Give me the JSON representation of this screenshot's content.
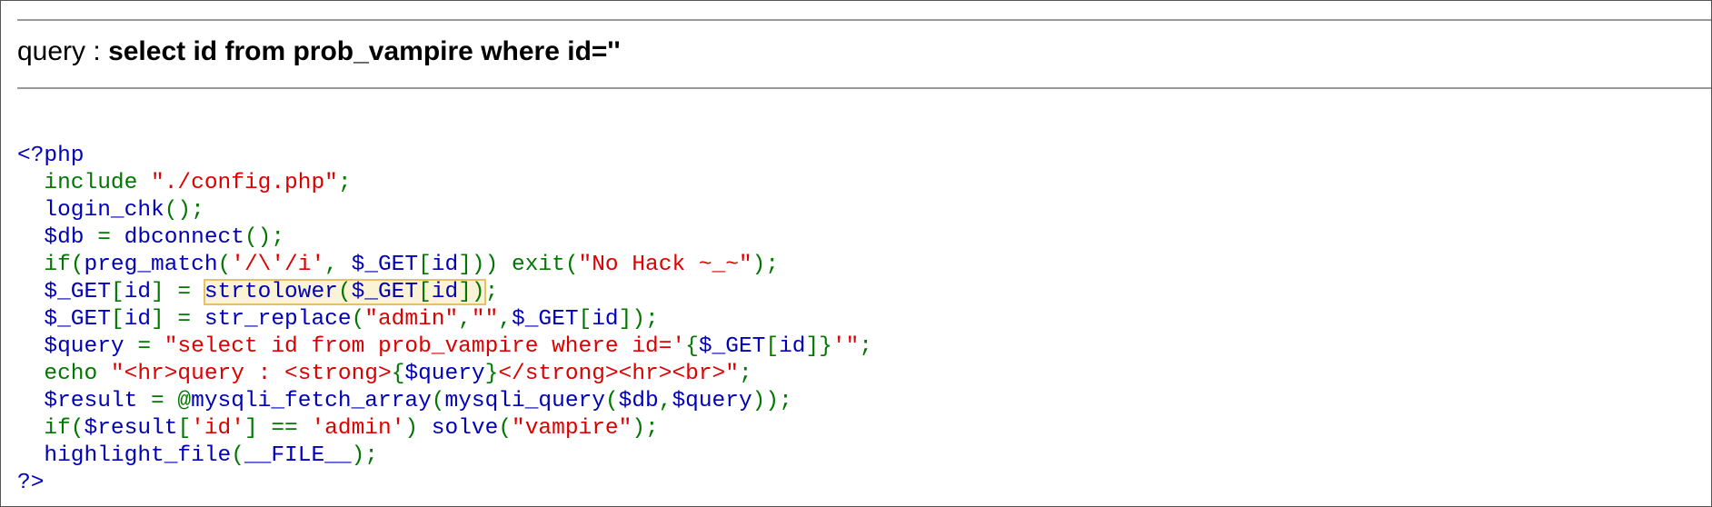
{
  "query": {
    "label": "query : ",
    "value": "select id from prob_vampire where id=''"
  },
  "source": {
    "lines": [
      [
        {
          "t": "<?php",
          "c": "var"
        }
      ],
      [
        {
          "t": "  include ",
          "c": "kw"
        },
        {
          "t": "\"./config.php\"",
          "c": "str"
        },
        {
          "t": ";",
          "c": "kw"
        }
      ],
      [
        {
          "t": "  login_chk",
          "c": "var"
        },
        {
          "t": "();",
          "c": "kw"
        }
      ],
      [
        {
          "t": "  $db ",
          "c": "var"
        },
        {
          "t": "= ",
          "c": "kw"
        },
        {
          "t": "dbconnect",
          "c": "var"
        },
        {
          "t": "();",
          "c": "kw"
        }
      ],
      [
        {
          "t": "  if(",
          "c": "kw"
        },
        {
          "t": "preg_match",
          "c": "var"
        },
        {
          "t": "(",
          "c": "kw"
        },
        {
          "t": "'/\\'/i'",
          "c": "str"
        },
        {
          "t": ", ",
          "c": "kw"
        },
        {
          "t": "$_GET",
          "c": "var"
        },
        {
          "t": "[",
          "c": "kw"
        },
        {
          "t": "id",
          "c": "var"
        },
        {
          "t": "])) exit(",
          "c": "kw"
        },
        {
          "t": "\"No Hack ~_~\"",
          "c": "str"
        },
        {
          "t": ");",
          "c": "kw"
        }
      ],
      [
        {
          "t": "  $_GET",
          "c": "var"
        },
        {
          "t": "[",
          "c": "kw"
        },
        {
          "t": "id",
          "c": "var"
        },
        {
          "t": "] = ",
          "c": "kw"
        },
        {
          "t": "strtolower",
          "c": "var",
          "hl": true
        },
        {
          "t": "(",
          "c": "kw",
          "hl": true
        },
        {
          "t": "$_GET",
          "c": "var",
          "hl": true
        },
        {
          "t": "[",
          "c": "kw",
          "hl": true
        },
        {
          "t": "id",
          "c": "var",
          "hl": true
        },
        {
          "t": "])",
          "c": "kw",
          "hl": true
        },
        {
          "t": ";",
          "c": "kw"
        }
      ],
      [
        {
          "t": "  $_GET",
          "c": "var"
        },
        {
          "t": "[",
          "c": "kw"
        },
        {
          "t": "id",
          "c": "var"
        },
        {
          "t": "] = ",
          "c": "kw"
        },
        {
          "t": "str_replace",
          "c": "var"
        },
        {
          "t": "(",
          "c": "kw"
        },
        {
          "t": "\"admin\"",
          "c": "str"
        },
        {
          "t": ",",
          "c": "kw"
        },
        {
          "t": "\"\"",
          "c": "str"
        },
        {
          "t": ",",
          "c": "kw"
        },
        {
          "t": "$_GET",
          "c": "var"
        },
        {
          "t": "[",
          "c": "kw"
        },
        {
          "t": "id",
          "c": "var"
        },
        {
          "t": "]);",
          "c": "kw"
        }
      ],
      [
        {
          "t": "  $query ",
          "c": "var"
        },
        {
          "t": "= ",
          "c": "kw"
        },
        {
          "t": "\"select id from prob_vampire where id='",
          "c": "str"
        },
        {
          "t": "{",
          "c": "kw"
        },
        {
          "t": "$_GET",
          "c": "var"
        },
        {
          "t": "[",
          "c": "kw"
        },
        {
          "t": "id",
          "c": "var"
        },
        {
          "t": "]}",
          "c": "kw"
        },
        {
          "t": "'\"",
          "c": "str"
        },
        {
          "t": ";",
          "c": "kw"
        }
      ],
      [
        {
          "t": "  echo ",
          "c": "kw"
        },
        {
          "t": "\"<hr>query : <strong>",
          "c": "str"
        },
        {
          "t": "{",
          "c": "kw"
        },
        {
          "t": "$query",
          "c": "var"
        },
        {
          "t": "}",
          "c": "kw"
        },
        {
          "t": "</strong><hr><br>\"",
          "c": "str"
        },
        {
          "t": ";",
          "c": "kw"
        }
      ],
      [
        {
          "t": "  $result ",
          "c": "var"
        },
        {
          "t": "= @",
          "c": "kw"
        },
        {
          "t": "mysqli_fetch_array",
          "c": "var"
        },
        {
          "t": "(",
          "c": "kw"
        },
        {
          "t": "mysqli_query",
          "c": "var"
        },
        {
          "t": "(",
          "c": "kw"
        },
        {
          "t": "$db",
          "c": "var"
        },
        {
          "t": ",",
          "c": "kw"
        },
        {
          "t": "$query",
          "c": "var"
        },
        {
          "t": "));",
          "c": "kw"
        }
      ],
      [
        {
          "t": "  if(",
          "c": "kw"
        },
        {
          "t": "$result",
          "c": "var"
        },
        {
          "t": "[",
          "c": "kw"
        },
        {
          "t": "'id'",
          "c": "str"
        },
        {
          "t": "] == ",
          "c": "kw"
        },
        {
          "t": "'admin'",
          "c": "str"
        },
        {
          "t": ") ",
          "c": "kw"
        },
        {
          "t": "solve",
          "c": "var"
        },
        {
          "t": "(",
          "c": "kw"
        },
        {
          "t": "\"vampire\"",
          "c": "str"
        },
        {
          "t": ");",
          "c": "kw"
        }
      ],
      [
        {
          "t": "  highlight_file",
          "c": "var"
        },
        {
          "t": "(",
          "c": "kw"
        },
        {
          "t": "__FILE__",
          "c": "var"
        },
        {
          "t": ");",
          "c": "kw"
        }
      ],
      [
        {
          "t": "?>",
          "c": "var"
        }
      ]
    ]
  }
}
